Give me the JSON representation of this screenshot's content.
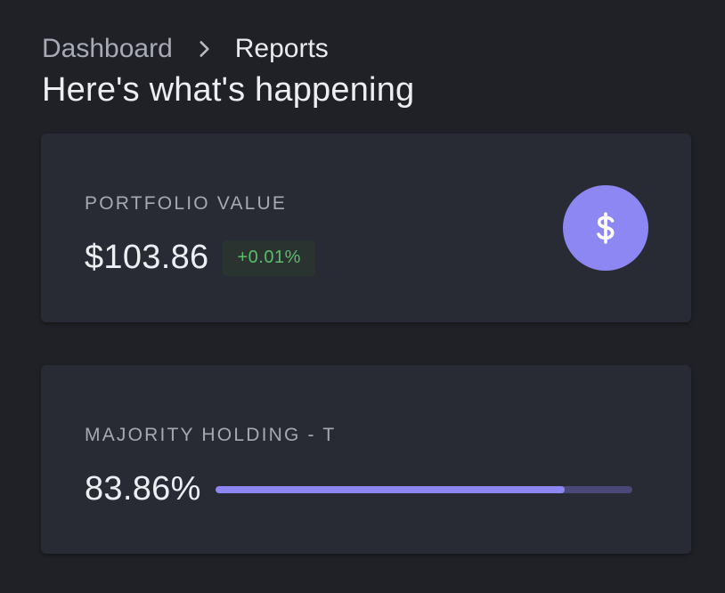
{
  "breadcrumb": {
    "parent": "Dashboard",
    "current": "Reports",
    "separator_icon": "chevron-right-icon"
  },
  "page_title": "Here's what's happening",
  "cards": [
    {
      "label": "PORTFOLIO VALUE",
      "value": "$103.86",
      "change": "+0.01%",
      "change_color": "#5bbd6a",
      "icon": "dollar-icon",
      "icon_bg": "#8c87f2"
    },
    {
      "label": "MAJORITY HOLDING - T",
      "value": "83.86%",
      "progress_fraction": 0.8386,
      "progress_color": "#8c87f2"
    }
  ]
}
